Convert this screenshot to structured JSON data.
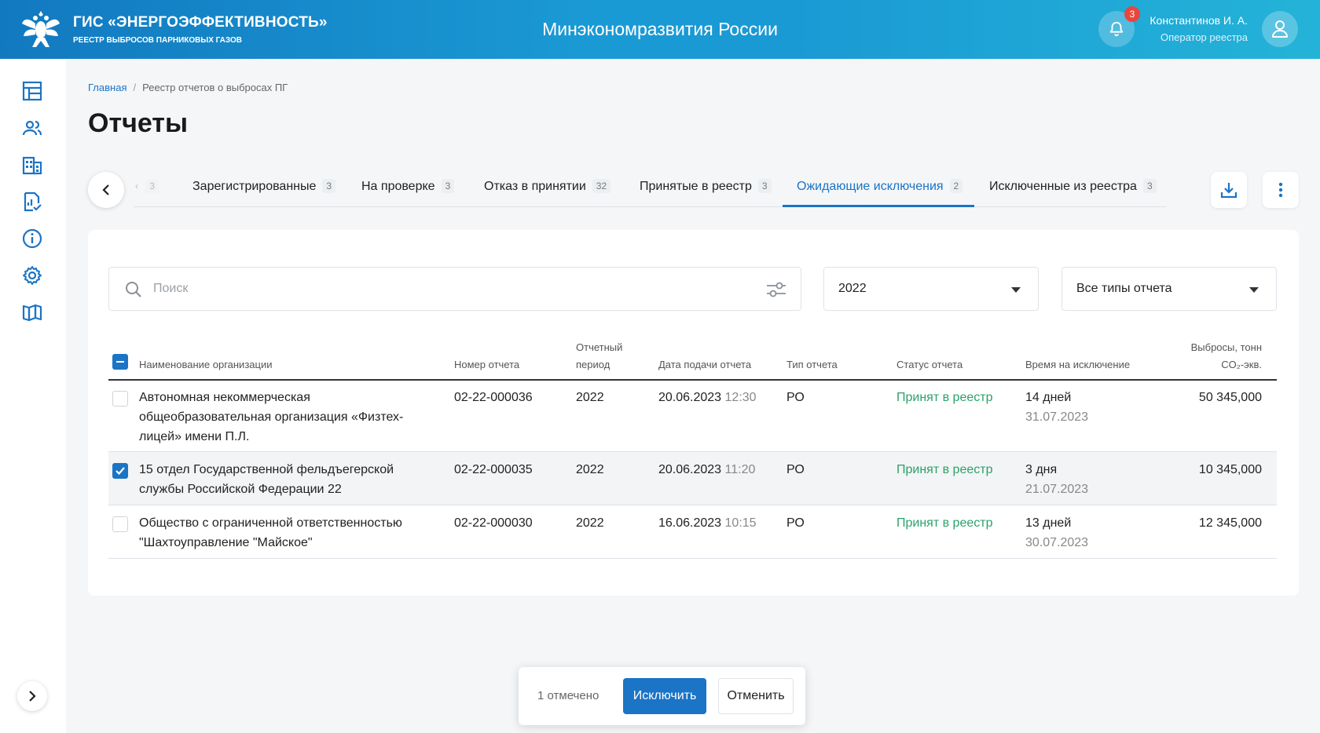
{
  "header": {
    "brand_title": "ГИС «ЭНЕРГОЭФФЕКТИВНОСТЬ»",
    "brand_subtitle": "РЕЕСТР ВЫБРОСОВ ПАРНИКОВЫХ ГАЗОВ",
    "ministry": "Минэкономразвития России",
    "notifications_count": "3",
    "user_name": "Константинов И. А.",
    "user_role": "Оператор реестра"
  },
  "sidebar": {
    "items": [
      "dashboard-icon",
      "users-icon",
      "buildings-icon",
      "report-check-icon",
      "info-icon",
      "settings-icon",
      "book-icon"
    ]
  },
  "breadcrumb": {
    "home": "Главная",
    "separator": "/",
    "current": "Реестр отчетов о выбросах ПГ"
  },
  "page_title": "Отчеты",
  "tabs": {
    "faded_count": "3",
    "items": [
      {
        "label": "Зарегистрированные",
        "count": "3"
      },
      {
        "label": "На проверке",
        "count": "3"
      },
      {
        "label": "Отказ в принятии",
        "count": "32"
      },
      {
        "label": "Принятые в реестр",
        "count": "3"
      },
      {
        "label": "Ожидающие исключения",
        "count": "2"
      },
      {
        "label": "Исключенные из реестра",
        "count": "3"
      }
    ],
    "active_index": 4
  },
  "filters": {
    "search_placeholder": "Поиск",
    "year": "2022",
    "report_type": "Все типы отчета"
  },
  "table": {
    "headers": {
      "org": "Наименование организации",
      "number": "Номер отчета",
      "period_1": "Отчетный",
      "period_2": "период",
      "date": "Дата подачи отчета",
      "type": "Тип отчета",
      "status": "Статус отчета",
      "time": "Время на исключение",
      "emissions_1": "Выбросы, тонн",
      "emissions_2": "CO₂-экв."
    },
    "rows": [
      {
        "org_1": "Автономная некоммерческая",
        "org_2": "общеобразовательная организация «Физтех-",
        "org_3": "лицей» имени П.Л.",
        "number": "02-22-000036",
        "period": "2022",
        "date": "20.06.2023",
        "time": "12:30",
        "type": "РО",
        "status": "Принят в реестр",
        "days": "14 дней",
        "deadline": "31.07.2023",
        "emissions": "50 345,000",
        "checked": false
      },
      {
        "org_1": "15 отдел Государственной фельдъегерской",
        "org_2": "службы Российской Федерации 22",
        "number": "02-22-000035",
        "period": "2022",
        "date": "20.06.2023",
        "time": "11:20",
        "type": "РО",
        "status": "Принят в реестр",
        "days": "3 дня",
        "deadline": "21.07.2023",
        "emissions": "10 345,000",
        "checked": true
      },
      {
        "org_1": "Общество с ограниченной ответственностью",
        "org_2": "\"Шахтоуправление \"Майское\"",
        "number": "02-22-000030",
        "period": "2022",
        "date": "16.06.2023",
        "time": "10:15",
        "type": "РО",
        "status": "Принят в реестр",
        "days": "13 дней",
        "deadline": "30.07.2023",
        "emissions": "12 345,000",
        "checked": false
      }
    ]
  },
  "actionbar": {
    "selected_text": "1 отмечено",
    "primary_label": "Исключить",
    "secondary_label": "Отменить"
  },
  "colors": {
    "accent": "#1b74c5",
    "status_green": "#2aa26b",
    "header_gradient_start": "#1279c0",
    "header_gradient_end": "#24b3d8"
  }
}
